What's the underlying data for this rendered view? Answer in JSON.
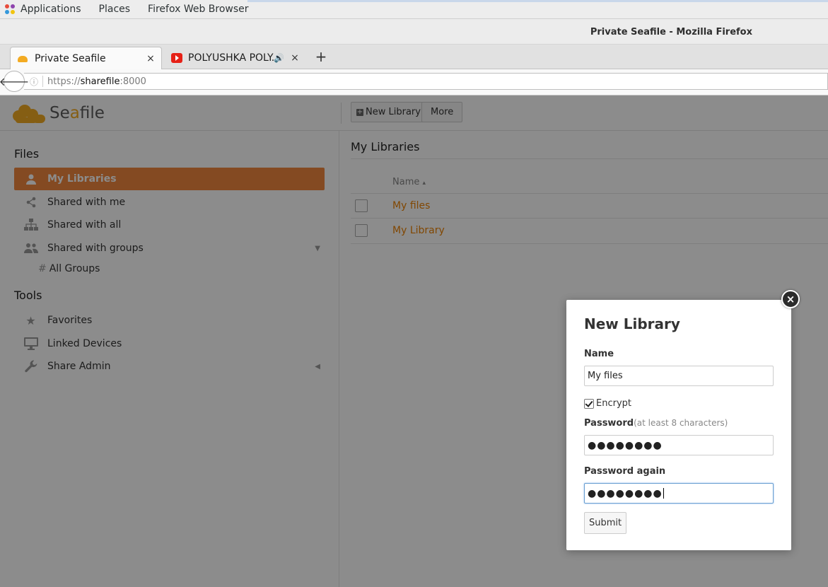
{
  "desktop": {
    "menus": [
      "Applications",
      "Places",
      "Firefox Web Browser"
    ]
  },
  "window": {
    "title": "Private Seafile - Mozilla Firefox"
  },
  "tabs": [
    {
      "label": "Private Seafile",
      "close": "×"
    },
    {
      "label": "POLYUSHKA POLY...",
      "audio": "🔊",
      "close": "×"
    }
  ],
  "new_tab_label": "+",
  "urlbar": {
    "scheme": "https://",
    "host": "sharefile",
    "port": ":8000"
  },
  "app": {
    "logo_prefix": "Se",
    "logo_accent": "a",
    "logo_suffix": "file",
    "new_library_button": "New Library",
    "more_button": "More",
    "accent_color": "#f0883e"
  },
  "sidebar": {
    "files_heading": "Files",
    "items": [
      {
        "label": "My Libraries",
        "icon": "user-icon"
      },
      {
        "label": "Shared with me",
        "icon": "share-icon"
      },
      {
        "label": "Shared with all",
        "icon": "org-chart-icon"
      },
      {
        "label": "Shared with groups",
        "icon": "group-icon"
      }
    ],
    "sub_items": [
      {
        "label": "All Groups"
      }
    ],
    "tools_heading": "Tools",
    "tools": [
      {
        "label": "Favorites",
        "icon": "star-icon"
      },
      {
        "label": "Linked Devices",
        "icon": "monitor-icon"
      },
      {
        "label": "Share Admin",
        "icon": "wrench-icon"
      }
    ]
  },
  "main": {
    "title": "My Libraries",
    "column_name": "Name",
    "sort_indicator": "▴",
    "libraries": [
      {
        "name": "My files",
        "encrypted": true
      },
      {
        "name": "My Library",
        "encrypted": false
      }
    ]
  },
  "dialog": {
    "title": "New Library",
    "name_label": "Name",
    "name_value": "My files",
    "encrypt_label": "Encrypt",
    "encrypt_checked": true,
    "password_label": "Password",
    "password_hint": "(at least 8 characters)",
    "password_mask": "●●●●●●●●",
    "password_again_label": "Password again",
    "password_again_mask": "●●●●●●●●",
    "submit_label": "Submit",
    "close_label": "×"
  }
}
